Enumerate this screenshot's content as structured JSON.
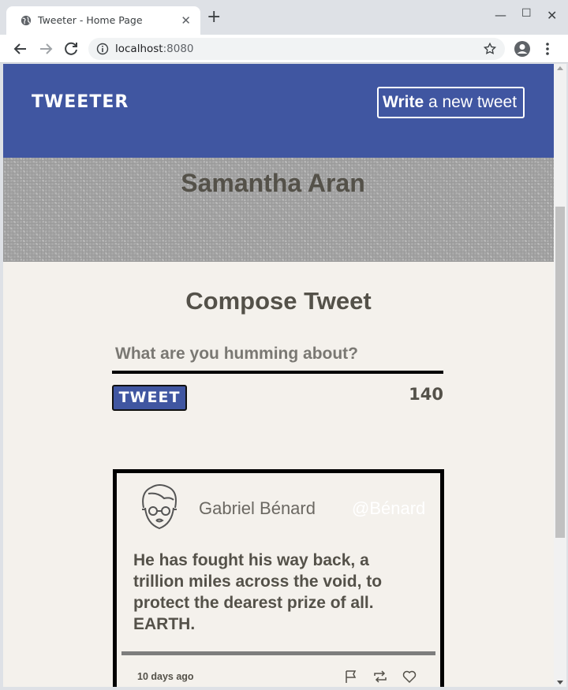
{
  "browser": {
    "tab_title": "Tweeter - Home Page",
    "url_host": "localhost",
    "url_port": ":8080",
    "icons": [
      "globe-icon",
      "close-icon",
      "plus-icon",
      "minimize-icon",
      "maximize-icon",
      "window-close-icon",
      "back-arrow-icon",
      "forward-arrow-icon",
      "reload-icon",
      "info-icon",
      "star-icon",
      "profile-icon",
      "kebab-menu-icon"
    ]
  },
  "header": {
    "logo": "TWEETER",
    "write_bold": "Write",
    "write_rest": " a new tweet",
    "bg_color": "#4056a1"
  },
  "profile": {
    "name": "Samantha Aran"
  },
  "compose": {
    "title": "Compose Tweet",
    "placeholder": "What are you humming about?",
    "submit_label": "TWEET",
    "counter": "140"
  },
  "tweets": [
    {
      "author": "Gabriel Bénard",
      "handle": "@Bénard",
      "text": "He has fought his way back, a trillion miles across the void, to protect the dearest prize of all. EARTH.",
      "age": "10 days ago",
      "actions": [
        "flag-icon",
        "retweet-icon",
        "heart-icon"
      ]
    }
  ]
}
